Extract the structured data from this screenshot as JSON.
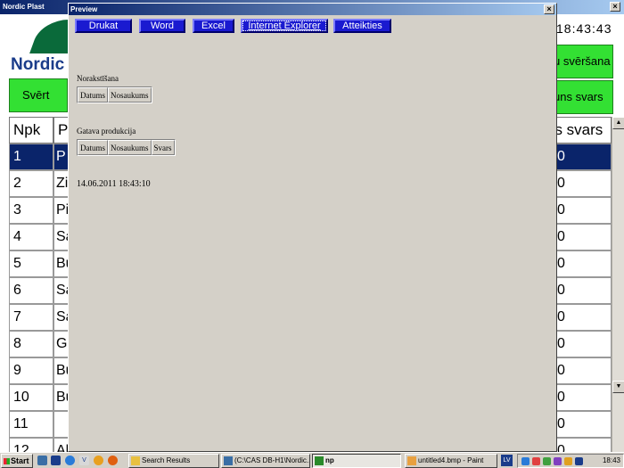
{
  "bg_window": {
    "title": "Nordic Plast",
    "close_glyph": "×",
    "logo_text": "Nordic",
    "svert_label": "Svērt",
    "clock": "18:43:43",
    "btn_sversana": "u svēršana",
    "btn_svars": "uns svars",
    "headers": {
      "npk": "Npk",
      "p": "Pr",
      "svars": "us svars"
    },
    "rows": [
      {
        "npk": "1",
        "p": "P",
        "v": "0"
      },
      {
        "npk": "2",
        "p": "Zi",
        "v": "0"
      },
      {
        "npk": "3",
        "p": "Pi",
        "v": "0"
      },
      {
        "npk": "4",
        "p": "Sa",
        "v": "0"
      },
      {
        "npk": "5",
        "p": "Bu",
        "v": "0"
      },
      {
        "npk": "6",
        "p": "Sa",
        "v": "0"
      },
      {
        "npk": "7",
        "p": "Sa",
        "v": "0"
      },
      {
        "npk": "8",
        "p": "G",
        "v": "0"
      },
      {
        "npk": "9",
        "p": "Bu",
        "v": "0"
      },
      {
        "npk": "10",
        "p": "Bu",
        "v": "0"
      },
      {
        "npk": "11",
        "p": "",
        "v": "0"
      },
      {
        "npk": "12",
        "p": "Al",
        "v": "0"
      }
    ]
  },
  "dialog": {
    "title": "Preview",
    "close_glyph": "×",
    "buttons": {
      "drukat": "Drukat",
      "word": "Word",
      "excel": "Excel",
      "ie": "Internet Explorer",
      "atteikties": "Atteikties"
    },
    "section1": {
      "title": "Norakstīšana",
      "cols": [
        "Datums",
        "Nosaukums"
      ]
    },
    "section2": {
      "title": "Gatava produkcija",
      "cols": [
        "Datums",
        "Nosaukums",
        "Svars"
      ]
    },
    "timestamp": "14.06.2011 18:43:10"
  },
  "taskbar": {
    "start_label": "Start",
    "tasks": [
      {
        "label": "Search Results",
        "icon": "folder-search-icon"
      },
      {
        "label": "(C:\\CAS DB-H1\\Nordic...",
        "icon": "app-window-icon"
      },
      {
        "label": "np",
        "icon": "np-app-icon"
      },
      {
        "label": "untitled4.bmp - Paint",
        "icon": "paint-icon"
      }
    ],
    "lang": "LV",
    "time": "18:43"
  },
  "colors": {
    "accent_blue": "#1a1ad0",
    "title_blue": "#0a246a",
    "green_button": "#33e033"
  }
}
